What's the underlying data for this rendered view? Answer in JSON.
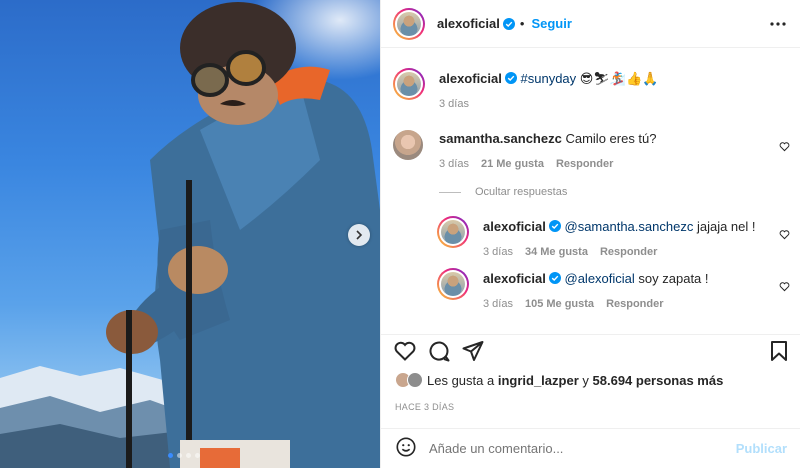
{
  "post": {
    "author": "alexoficial",
    "follow_label": "Seguir",
    "separator": "•",
    "caption_hashtag": "#sunyday",
    "caption_emojis": "😎⛷🏂👍🙏",
    "caption_age": "3 días"
  },
  "comments": [
    {
      "user": "samantha.sanchezc",
      "text": "Camilo eres tú?",
      "age": "3 días",
      "likes": "21 Me gusta",
      "reply": "Responder"
    }
  ],
  "hide_replies_label": "Ocultar respuestas",
  "replies": [
    {
      "user": "alexoficial",
      "mention": "@samantha.sanchezc",
      "text": "jajaja nel !",
      "age": "3 días",
      "likes": "34 Me gusta",
      "reply": "Responder"
    },
    {
      "user": "alexoficial",
      "mention": "@alexoficial",
      "text": "soy zapata !",
      "age": "3 días",
      "likes": "105 Me gusta",
      "reply": "Responder"
    }
  ],
  "likes_summary": {
    "prefix": "Les gusta a",
    "user": "ingrid_lazper",
    "conj": "y",
    "count": "58.694 personas más"
  },
  "posted_ago": "HACE 3 DÍAS",
  "composer": {
    "placeholder": "Añade un comentario...",
    "publish_label": "Publicar"
  },
  "colors": {
    "link_blue": "#0095f6",
    "mention_blue": "#00376b",
    "muted": "#8e8e8e"
  },
  "icons": [
    "more-options-icon",
    "heart-icon",
    "comment-icon",
    "share-icon",
    "bookmark-icon",
    "emoji-icon",
    "verified-icon",
    "chevron-right-icon"
  ]
}
